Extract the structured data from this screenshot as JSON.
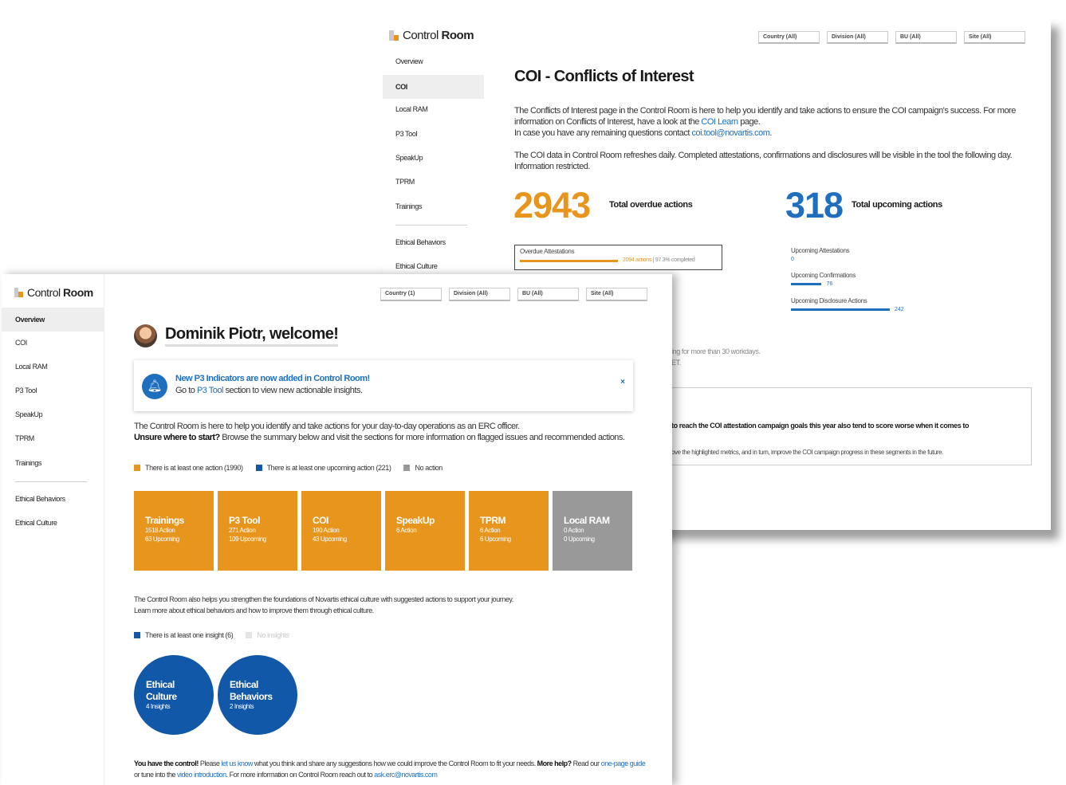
{
  "brand": {
    "name_light": "Control",
    "name_bold": "Room"
  },
  "colors": {
    "orange": "#e8951d",
    "blue": "#1f6fbf",
    "dark_blue": "#1258a8",
    "gray": "#999999"
  },
  "coi_window": {
    "sidebar": [
      "Overview",
      "COI",
      "Local RAM",
      "P3 Tool",
      "SpeakUp",
      "TPRM",
      "Trainings",
      "Ethical Behaviors",
      "Ethical Culture"
    ],
    "filters": [
      "Country (All)",
      "Division (All)",
      "BU (All)",
      "Site (All)"
    ],
    "title": "COI - Conflicts of Interest",
    "para1_a": "The Conflicts of Interest page in the Control Room is here to help you identify and take actions to ensure the COI campaign's success. For more information on Conflicts of Interest, have a look at the ",
    "para1_link": "COI Learn",
    "para1_b": " page.",
    "para1_c": "In case you have any remaining questions contact ",
    "para1_email": "coi.tool@novartis.com",
    "para1_d": ".",
    "para2": "The COI data in Control Room refreshes daily. Completed attestations, confirmations and disclosures will be visible in the tool the following day. Information restricted.",
    "overdue_total": "2943",
    "overdue_label": "Total overdue actions",
    "upcoming_total": "318",
    "upcoming_label": "Total upcoming actions",
    "overdue_attestations": {
      "label": "Overdue Attestations",
      "value": "2094 actions",
      "completed": " | 97.3% completed",
      "progress": 0.973
    },
    "upcoming": [
      {
        "label": "Upcoming Attestations",
        "value": "0",
        "fraction": 0
      },
      {
        "label": "Upcoming Confirmations",
        "value": "76",
        "fraction": 0.31
      },
      {
        "label": "Upcoming Disclosure Actions",
        "value": "242",
        "fraction": 1
      }
    ],
    "frag1": "ing for more than 30 workdays.",
    "frag2": "ET.",
    "insight_line1": "to reach the COI attestation campaign goals this year also tend to score worse when it comes to",
    "insight_line2": "ove the highlighted metrics, and in turn, improve the COI campaign progress in these segments in the future."
  },
  "overview_window": {
    "sidebar": [
      "Overview",
      "COI",
      "Local RAM",
      "P3 Tool",
      "SpeakUp",
      "TPRM",
      "Trainings",
      "Ethical Behaviors",
      "Ethical Culture"
    ],
    "filters": [
      "Country (1)",
      "Division (All)",
      "BU (All)",
      "Site (All)"
    ],
    "welcome": "Dominik Piotr, welcome!",
    "notice_title": "New P3 Indicators are now added in Control Room!",
    "notice_a": "Go to ",
    "notice_link": "P3 Tool",
    "notice_b": " section to view new actionable insights.",
    "notice_close": "×",
    "intro_line1": "The Control Room is here to help you identify and take actions for your day-to-day operations as an ERC officer.",
    "intro_bold": "Unsure where to start?",
    "intro_line2": " Browse the summary below and visit the sections for more information on flagged issues and recommended actions.",
    "legend1": [
      "There is at least one action (1990)",
      "There is at least one upcoming action (221)",
      "No action"
    ],
    "tiles": [
      {
        "title": "Trainings",
        "line1": "1518 Action",
        "line2": "63 Upcoming",
        "color": "#e8951d"
      },
      {
        "title": "P3 Tool",
        "line1": "271 Action",
        "line2": "109 Upcoming",
        "color": "#e8951d"
      },
      {
        "title": "COI",
        "line1": "190 Action",
        "line2": "43 Upcoming",
        "color": "#e8951d"
      },
      {
        "title": "SpeakUp",
        "line1": "6 Action",
        "line2": "",
        "color": "#e8951d"
      },
      {
        "title": "TPRM",
        "line1": "6 Action",
        "line2": "6 Upcoming",
        "color": "#e8951d"
      },
      {
        "title": "Local RAM",
        "line1": "0 Action",
        "line2": "0 Upcoming",
        "color": "#999999"
      }
    ],
    "ethics_line1": "The Control Room also helps you strengthen the foundations of Novartis ethical culture with suggested actions to support your journey.",
    "ethics_line2": "Learn more about ethical behaviors and how to improve them through ethical culture.",
    "legend2": [
      "There is at least one insight (6)",
      "No insights"
    ],
    "circles": [
      {
        "title1": "Ethical",
        "title2": "Culture",
        "sub": "4 Insights"
      },
      {
        "title1": "Ethical",
        "title2": "Behaviors",
        "sub": "2 Insights"
      }
    ],
    "footer_bold1": "You have the control!",
    "footer_a": " Please ",
    "footer_link1": "let us know",
    "footer_b": " what you think and share any suggestions how we could improve the Control Room to fit your needs. ",
    "footer_bold2": "More help?",
    "footer_c": " Read our ",
    "footer_link2": "one-page guide",
    "footer_d": " or tune into the ",
    "footer_link3": "video introduction",
    "footer_e": ". For more information on Control Room reach out to ",
    "footer_link4": "ask.erc@novartis.com"
  }
}
